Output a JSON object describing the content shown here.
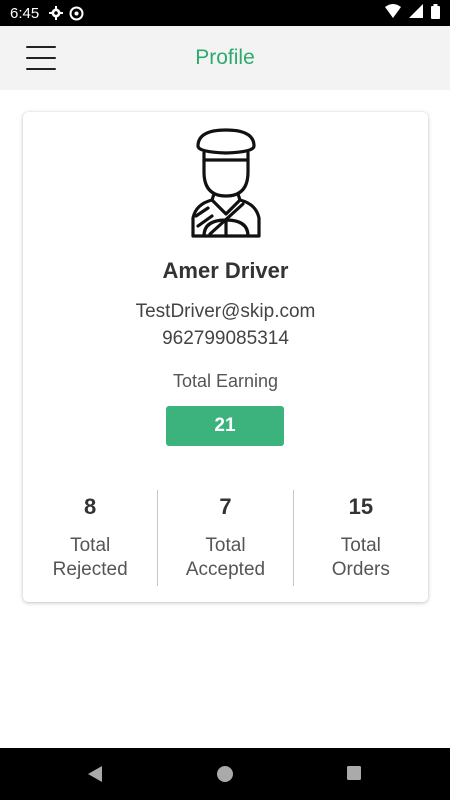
{
  "status_bar": {
    "time": "6:45"
  },
  "app_bar": {
    "title": "Profile"
  },
  "profile": {
    "name": "Amer Driver",
    "email": "TestDriver@skip.com",
    "phone": "962799085314",
    "earning_label": "Total Earning",
    "earning_value": "21"
  },
  "stats": [
    {
      "value": "8",
      "label_line1": "Total",
      "label_line2": "Rejected"
    },
    {
      "value": "7",
      "label_line1": "Total",
      "label_line2": "Accepted"
    },
    {
      "value": "15",
      "label_line1": "Total",
      "label_line2": "Orders"
    }
  ],
  "colors": {
    "accent": "#2eaa6e",
    "badge": "#3cb37d"
  },
  "icons": [
    "gear-icon",
    "sync-icon",
    "wifi-icon",
    "signal-icon",
    "battery-icon",
    "menu-icon",
    "driver-avatar-icon",
    "back-icon",
    "home-icon",
    "recents-icon"
  ]
}
